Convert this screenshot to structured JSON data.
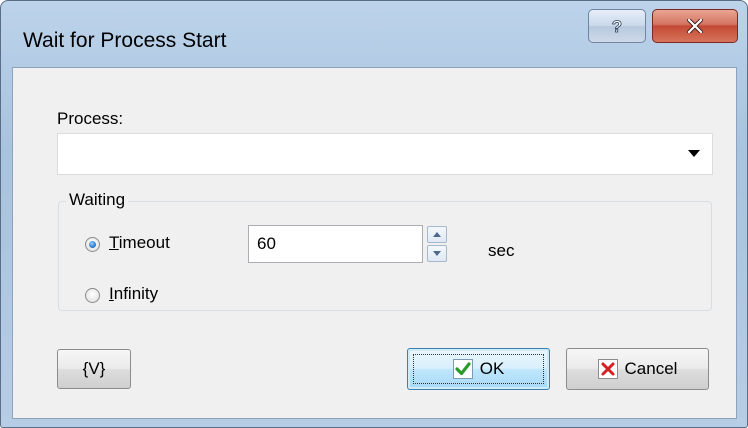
{
  "window": {
    "title": "Wait for Process Start",
    "help_icon": "help-icon",
    "close_icon": "close-icon"
  },
  "process": {
    "label": "Process:",
    "value": "",
    "dropdown_icon": "chevron-down-icon"
  },
  "waiting": {
    "legend": "Waiting",
    "timeout": {
      "label_mnemonic": "T",
      "label_rest": "imeout",
      "checked": true
    },
    "infinity": {
      "label_mnemonic": "I",
      "label_rest": "nfinity",
      "checked": false
    },
    "timeout_value": "60",
    "unit": "sec"
  },
  "buttons": {
    "variables": "{V}",
    "ok": "OK",
    "ok_icon": "check-icon",
    "cancel": "Cancel",
    "cancel_icon": "x-icon"
  },
  "colors": {
    "check": "#2a9a2a",
    "cancel_x": "#d42020",
    "close_button": "#c24a35"
  }
}
